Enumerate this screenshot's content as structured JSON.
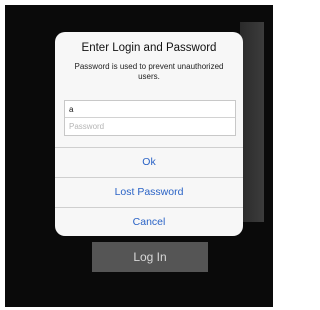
{
  "background_screen": {
    "login_button_label": "Log In"
  },
  "dialog": {
    "title": "Enter Login and Password",
    "message": "Password is used to prevent unauthorized users.",
    "username_value": "a",
    "password_placeholder": "Password",
    "buttons": {
      "ok": "Ok",
      "lost_password": "Lost Password",
      "cancel": "Cancel"
    }
  },
  "colors": {
    "accent": "#2a63c6",
    "dialog_background": "#f7f7f7",
    "backdrop": "#0a0a0a"
  }
}
